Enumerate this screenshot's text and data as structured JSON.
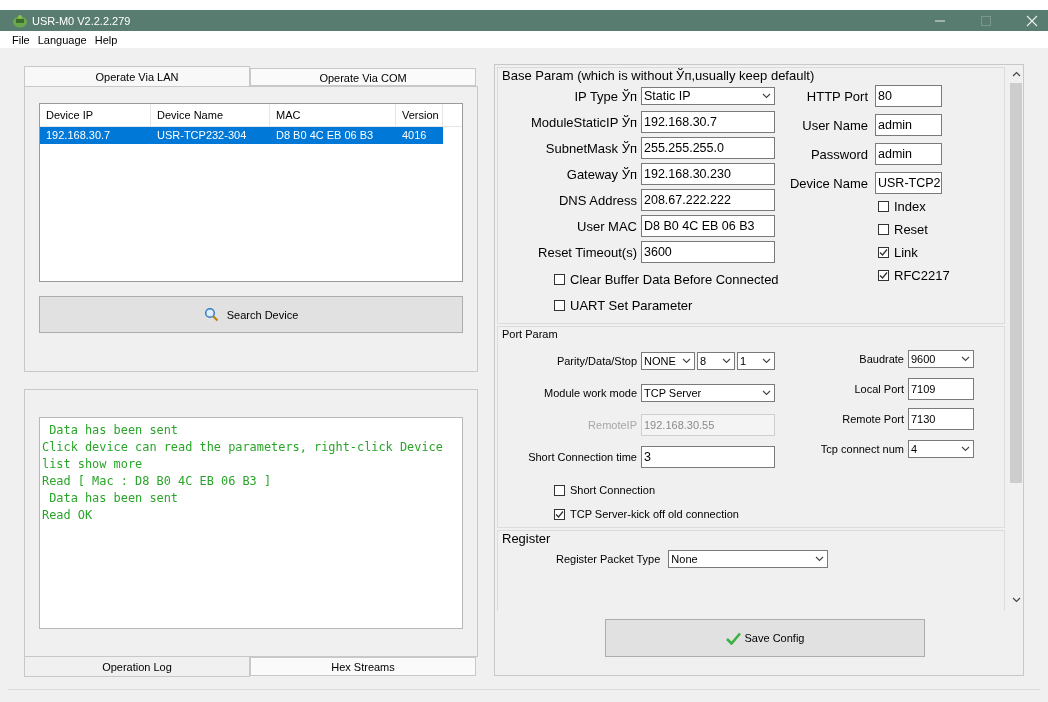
{
  "window": {
    "title": "USR-M0 V2.2.2.279"
  },
  "menu": [
    "File",
    "Language",
    "Help"
  ],
  "left_tabs": [
    {
      "label": "Operate Via LAN",
      "selected": true
    },
    {
      "label": "Operate Via COM",
      "selected": false
    }
  ],
  "device_table": {
    "columns": [
      "Device IP",
      "Device Name",
      "MAC",
      "Version"
    ],
    "rows": [
      {
        "cells": [
          "192.168.30.7",
          "USR-TCP232-304",
          "D8 B0 4C EB 06 B3",
          "4016"
        ],
        "selected": true
      }
    ]
  },
  "search_button": "Search Device",
  "log": {
    "lines": [
      " Data has been sent",
      "Click device can read the parameters, right-click Device list show more",
      "Read [ Mac : D8 B0 4C EB 06 B3 ]",
      " Data has been sent",
      "Read OK"
    ]
  },
  "log_tabs": [
    {
      "label": "Operation Log",
      "selected": true
    },
    {
      "label": "Hex Streams",
      "selected": false
    }
  ],
  "base_param": {
    "title": "Base Param (which is without Ўп,usually keep default)",
    "left_fields": [
      {
        "label": "IP Type Ўп",
        "value": "Static IP",
        "kind": "select"
      },
      {
        "label": "ModuleStaticIP Ўп",
        "value": "192.168.30.7",
        "kind": "text"
      },
      {
        "label": "SubnetMask Ўп",
        "value": "255.255.255.0",
        "kind": "text"
      },
      {
        "label": "Gateway Ўп",
        "value": "192.168.30.230",
        "kind": "text"
      },
      {
        "label": "DNS Address",
        "value": "208.67.222.222",
        "kind": "text"
      },
      {
        "label": "User MAC",
        "value": "D8 B0 4C EB 06 B3",
        "kind": "text"
      },
      {
        "label": "Reset Timeout(s)",
        "value": "3600",
        "kind": "text"
      }
    ],
    "left_checks": [
      {
        "label": "Clear Buffer Data Before Connected",
        "checked": false
      },
      {
        "label": "UART Set Parameter",
        "checked": false
      }
    ],
    "right_fields": [
      {
        "label": "HTTP Port",
        "value": "80"
      },
      {
        "label": "User Name",
        "value": "admin"
      },
      {
        "label": "Password",
        "value": "admin"
      },
      {
        "label": "Device Name",
        "value": "USR-TCP2"
      }
    ],
    "right_checks": [
      {
        "label": "Index",
        "checked": false
      },
      {
        "label": "Reset",
        "checked": false
      },
      {
        "label": "Link",
        "checked": true
      },
      {
        "label": "RFC2217",
        "checked": true
      }
    ]
  },
  "port_param": {
    "title": "Port Param",
    "left_fields": [
      {
        "label": "Parity/Data/Stop",
        "values": [
          "NONE",
          "8",
          "1"
        ],
        "kind": "selects",
        "disabled": false
      },
      {
        "label": "Module work mode",
        "value": "TCP Server",
        "kind": "select",
        "disabled": false
      },
      {
        "label": "RemoteIP",
        "value": "192.168.30.55",
        "kind": "text",
        "disabled": true
      },
      {
        "label": "Short Connection time",
        "value": "3",
        "kind": "text",
        "disabled": false
      }
    ],
    "checks": [
      {
        "label": "Short Connection",
        "checked": false
      },
      {
        "label": "TCP Server-kick off old connection",
        "checked": true
      }
    ],
    "right_fields": [
      {
        "label": "Baudrate",
        "value": "9600",
        "kind": "select"
      },
      {
        "label": "Local Port",
        "value": "7109",
        "kind": "text"
      },
      {
        "label": "Remote Port",
        "value": "7130",
        "kind": "text"
      },
      {
        "label": "Tcp connect num",
        "value": "4",
        "kind": "select"
      }
    ]
  },
  "register": {
    "title": "Register",
    "fields": [
      {
        "label": "Register Packet Type",
        "value": "None",
        "kind": "select"
      }
    ]
  },
  "save_button": "Save Config"
}
